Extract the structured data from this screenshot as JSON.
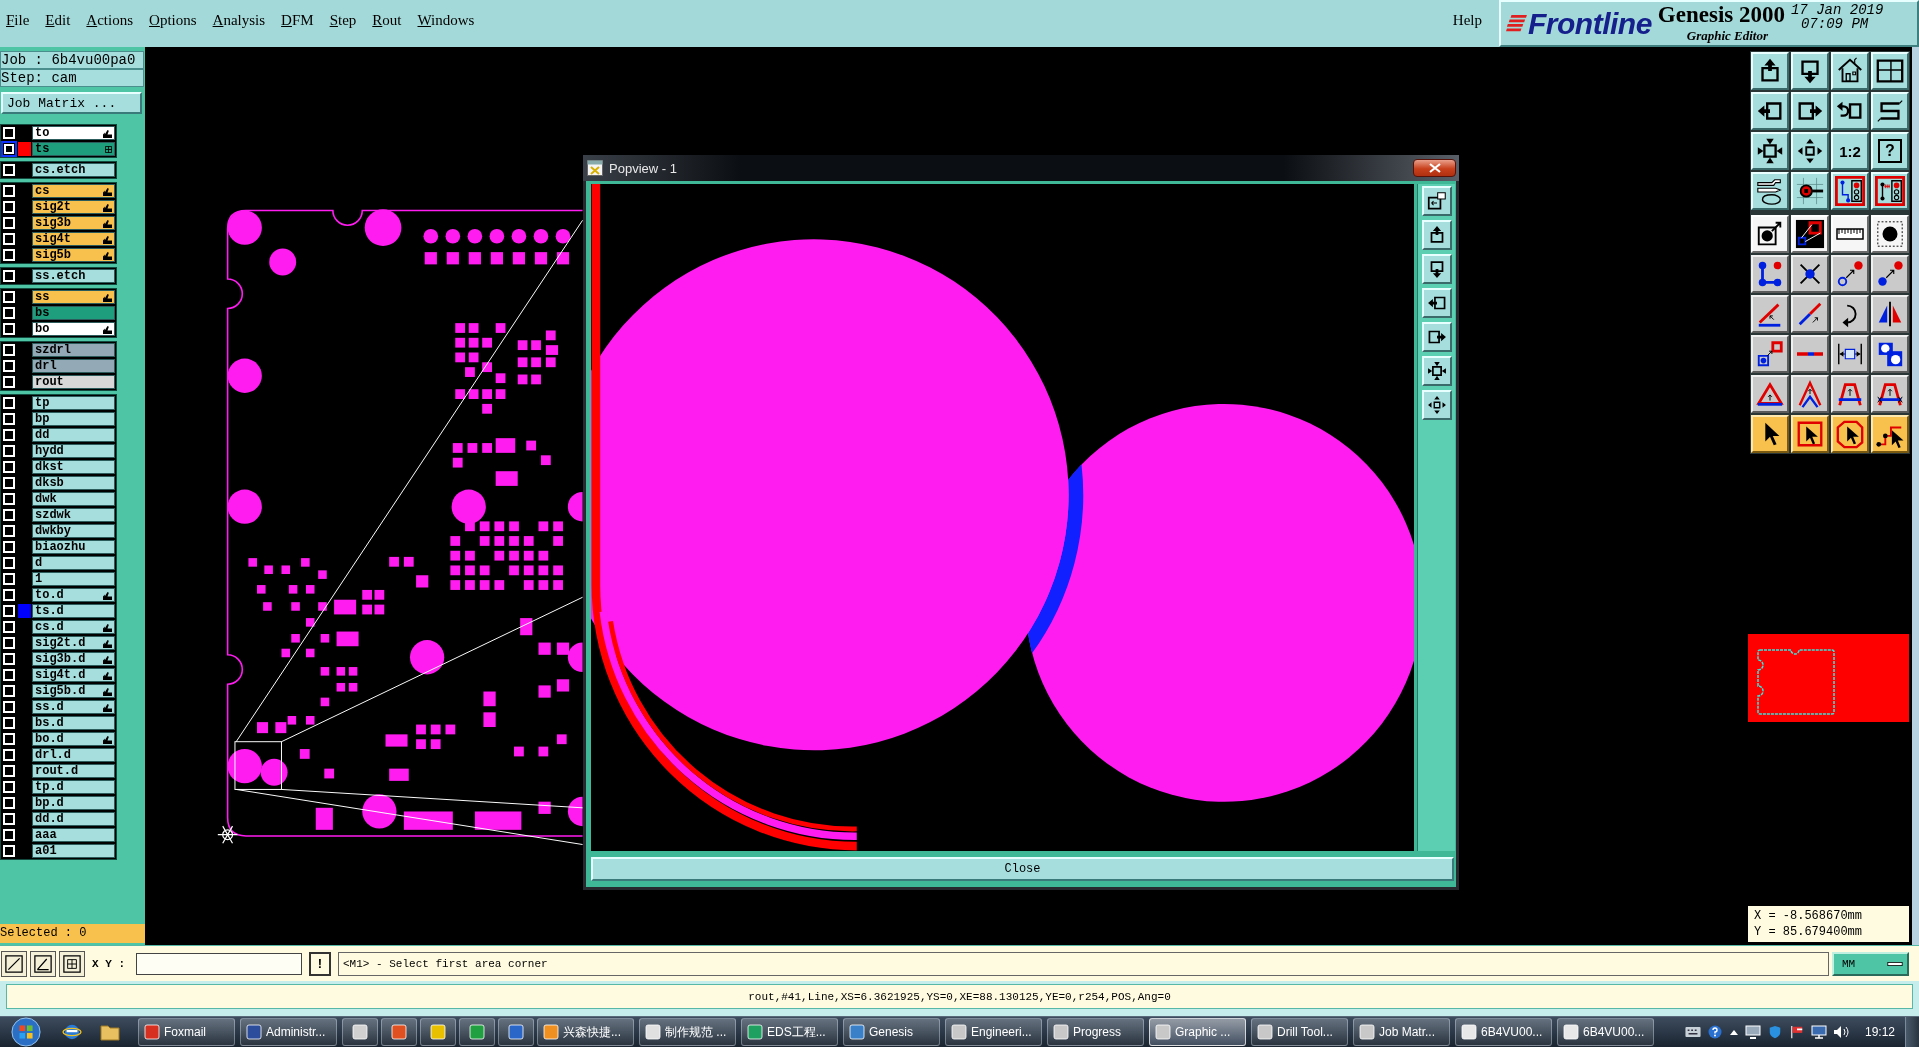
{
  "menu_bar": {
    "items": [
      "File",
      "Edit",
      "Actions",
      "Options",
      "Analysis",
      "DFM",
      "Step",
      "Rout",
      "Windows"
    ],
    "help": "Help"
  },
  "brand": {
    "logo": "Frontline",
    "product": "Genesis 2000",
    "subtitle": "Graphic Editor",
    "date": "17 Jan 2019",
    "time": "07:09 PM"
  },
  "job_panel": {
    "job": "Job : 6b4vu00pa0",
    "step": "Step: cam",
    "job_matrix_button": "Job Matrix ...",
    "layer_groups": [
      {
        "layers": [
          {
            "name": "to",
            "checked": false,
            "selected": false,
            "affected": true,
            "color": "#ffffff"
          },
          {
            "name": "ts",
            "checked": false,
            "selected": true,
            "affected": false,
            "color": "#1f9e7e",
            "swatch": {
              "color": "#ff0000"
            }
          }
        ]
      },
      {
        "layers": [
          {
            "name": "cs.etch",
            "checked": false,
            "selected": false,
            "affected": false,
            "color": "#a6dede"
          }
        ]
      },
      {
        "layers": [
          {
            "name": "cs",
            "checked": false,
            "selected": false,
            "affected": true,
            "color": "#f8c04c"
          },
          {
            "name": "sig2t",
            "checked": false,
            "selected": false,
            "affected": true,
            "color": "#f8c04c"
          },
          {
            "name": "sig3b",
            "checked": false,
            "selected": false,
            "affected": true,
            "color": "#f8c04c"
          },
          {
            "name": "sig4t",
            "checked": false,
            "selected": false,
            "affected": true,
            "color": "#f8c04c"
          },
          {
            "name": "sig5b",
            "checked": false,
            "selected": false,
            "affected": true,
            "color": "#f8c04c"
          }
        ]
      },
      {
        "layers": [
          {
            "name": "ss.etch",
            "checked": false,
            "selected": false,
            "affected": false,
            "color": "#a6dede"
          }
        ]
      },
      {
        "layers": [
          {
            "name": "ss",
            "checked": false,
            "selected": false,
            "affected": true,
            "color": "#f8c04c"
          },
          {
            "name": "bs",
            "checked": false,
            "selected": false,
            "affected": false,
            "color": "#1f9e7e"
          },
          {
            "name": "bo",
            "checked": false,
            "selected": false,
            "affected": true,
            "color": "#ffffff"
          }
        ]
      },
      {
        "layers": [
          {
            "name": "szdrl",
            "checked": false,
            "selected": false,
            "affected": false,
            "color": "#93aab6"
          },
          {
            "name": "drl",
            "checked": false,
            "selected": false,
            "affected": false,
            "color": "#93aab6"
          },
          {
            "name": "rout",
            "checked": false,
            "selected": false,
            "affected": false,
            "color": "#d8d8d8"
          }
        ]
      },
      {
        "layers": [
          {
            "name": "tp",
            "checked": false,
            "selected": false,
            "affected": false,
            "color": "#a6dede"
          },
          {
            "name": "bp",
            "checked": false,
            "selected": false,
            "affected": false,
            "color": "#a6dede"
          },
          {
            "name": "dd",
            "checked": false,
            "selected": false,
            "affected": false,
            "color": "#a6dede"
          },
          {
            "name": "hydd",
            "checked": false,
            "selected": false,
            "affected": false,
            "color": "#a6dede"
          },
          {
            "name": "dkst",
            "checked": false,
            "selected": false,
            "affected": false,
            "color": "#a6dede"
          },
          {
            "name": "dksb",
            "checked": false,
            "selected": false,
            "affected": false,
            "color": "#a6dede"
          },
          {
            "name": "dwk",
            "checked": false,
            "selected": false,
            "affected": false,
            "color": "#a6dede"
          },
          {
            "name": "szdwk",
            "checked": false,
            "selected": false,
            "affected": false,
            "color": "#a6dede"
          },
          {
            "name": "dwkby",
            "checked": false,
            "selected": false,
            "affected": false,
            "color": "#a6dede"
          },
          {
            "name": "biaozhu",
            "checked": false,
            "selected": false,
            "affected": false,
            "color": "#a6dede"
          },
          {
            "name": "d",
            "checked": false,
            "selected": false,
            "affected": false,
            "color": "#a6dede"
          },
          {
            "name": "1",
            "checked": false,
            "selected": false,
            "affected": false,
            "color": "#a6dede"
          },
          {
            "name": "to.d",
            "checked": false,
            "selected": false,
            "affected": true,
            "color": "#a6dede"
          },
          {
            "name": "ts.d",
            "checked": false,
            "selected": false,
            "affected": false,
            "color": "#a6dede",
            "swatch": {
              "color": "#0000ff"
            }
          },
          {
            "name": "cs.d",
            "checked": false,
            "selected": false,
            "affected": true,
            "color": "#a6dede"
          },
          {
            "name": "sig2t.d",
            "checked": false,
            "selected": false,
            "affected": true,
            "color": "#a6dede"
          },
          {
            "name": "sig3b.d",
            "checked": false,
            "selected": false,
            "affected": true,
            "color": "#a6dede"
          },
          {
            "name": "sig4t.d",
            "checked": false,
            "selected": false,
            "affected": true,
            "color": "#a6dede"
          },
          {
            "name": "sig5b.d",
            "checked": false,
            "selected": false,
            "affected": true,
            "color": "#a6dede"
          },
          {
            "name": "ss.d",
            "checked": false,
            "selected": false,
            "affected": true,
            "color": "#a6dede"
          },
          {
            "name": "bs.d",
            "checked": false,
            "selected": false,
            "affected": false,
            "color": "#a6dede"
          },
          {
            "name": "bo.d",
            "checked": false,
            "selected": false,
            "affected": true,
            "color": "#a6dede"
          },
          {
            "name": "drl.d",
            "checked": false,
            "selected": false,
            "affected": false,
            "color": "#a6dede"
          },
          {
            "name": "rout.d",
            "checked": false,
            "selected": false,
            "affected": false,
            "color": "#a6dede"
          },
          {
            "name": "tp.d",
            "checked": false,
            "selected": false,
            "affected": false,
            "color": "#a6dede"
          },
          {
            "name": "bp.d",
            "checked": false,
            "selected": false,
            "affected": false,
            "color": "#a6dede"
          },
          {
            "name": "dd.d",
            "checked": false,
            "selected": false,
            "affected": false,
            "color": "#a6dede"
          },
          {
            "name": "aaa",
            "checked": false,
            "selected": false,
            "affected": false,
            "color": "#a6dede"
          },
          {
            "name": "a01",
            "checked": false,
            "selected": false,
            "affected": false,
            "color": "#a6dede"
          }
        ]
      }
    ],
    "selected_count": "Selected : 0"
  },
  "popview": {
    "title": "Popview - 1",
    "close_button": "Close"
  },
  "tool_palette": {
    "scale_button": "1:2",
    "help_button": "?"
  },
  "cursor_position": {
    "x": "X = -8.568670mm",
    "y": "Y = 85.679400mm"
  },
  "command_line": {
    "xy_label": "X Y :",
    "execute_button": "!",
    "prompt": "<M1> - Select first area corner",
    "units": "MM"
  },
  "status_line": "rout,#41,Line,XS=6.3621925,YS=0,XE=88.130125,YE=0,r254,POS,Ang=0",
  "taskbar": {
    "items": [
      {
        "kind": "app",
        "label": "Foxmail",
        "selected": false
      },
      {
        "kind": "app",
        "label": "Administr...",
        "selected": false
      },
      {
        "kind": "icon",
        "selected": false
      },
      {
        "kind": "icon",
        "selected": false
      },
      {
        "kind": "icon",
        "selected": false
      },
      {
        "kind": "icon",
        "selected": false
      },
      {
        "kind": "icon",
        "selected": false
      },
      {
        "kind": "app",
        "label": "兴森快捷...",
        "selected": false
      },
      {
        "kind": "app",
        "label": "制作规范 ...",
        "selected": false
      },
      {
        "kind": "app",
        "label": "EDS工程...",
        "selected": false
      },
      {
        "kind": "app",
        "label": "Genesis",
        "selected": false
      },
      {
        "kind": "app",
        "label": "Engineeri...",
        "selected": false
      },
      {
        "kind": "app",
        "label": "Progress",
        "selected": false
      },
      {
        "kind": "app",
        "label": "Graphic ...",
        "selected": true
      },
      {
        "kind": "app",
        "label": "Drill Tool...",
        "selected": false
      },
      {
        "kind": "app",
        "label": "Job Matr...",
        "selected": false
      },
      {
        "kind": "app",
        "label": "6B4VU00...",
        "selected": false
      },
      {
        "kind": "app",
        "label": "6B4VU00...",
        "selected": false
      }
    ],
    "clock": "19:12"
  }
}
